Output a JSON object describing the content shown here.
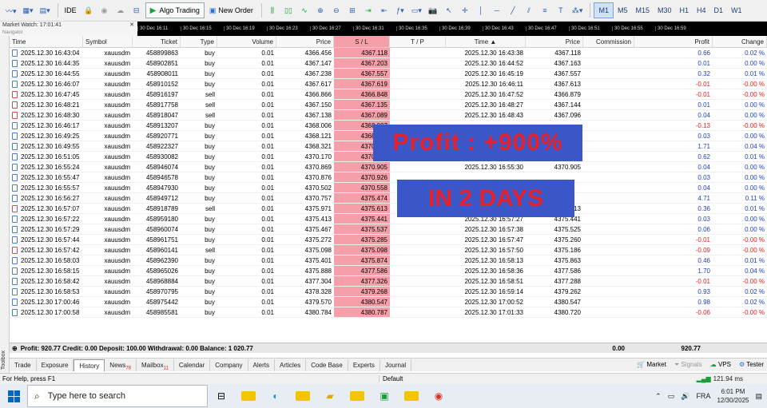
{
  "toolbar": {
    "ide_label": "IDE",
    "algo_label": "Algo Trading",
    "new_order_label": "New Order",
    "timeframes": [
      "M1",
      "M5",
      "M15",
      "M30",
      "H1",
      "H4",
      "D1",
      "W1"
    ],
    "active_timeframe": "M1"
  },
  "market_watch": {
    "title": "Market Watch: 17:01:41",
    "sub": "Navigator"
  },
  "timescale": [
    "30 Dec 16:11",
    "30 Dec 16:15",
    "30 Dec 16:19",
    "30 Dec 16:23",
    "30 Dec 16:27",
    "30 Dec 16:31",
    "30 Dec 16:35",
    "30 Dec 16:39",
    "30 Dec 16:43",
    "30 Dec 16:47",
    "30 Dec 16:51",
    "30 Dec 16:55",
    "30 Dec 16:59"
  ],
  "columns": {
    "time": "Time",
    "symbol": "Symbol",
    "ticket": "Ticket",
    "type": "Type",
    "volume": "Volume",
    "price": "Price",
    "sl": "S / L",
    "tp": "T / P",
    "close_time": "Time ▲",
    "close_price": "Price",
    "commission": "Commission",
    "profit": "Profit",
    "change": "Change"
  },
  "rows": [
    {
      "time": "2025.12.30 16:43:04",
      "symbol": "xauusdm",
      "ticket": "458899863",
      "type": "buy",
      "volume": "0.01",
      "price": "4366.456",
      "sl": "4367.118",
      "tp": "",
      "ctime": "2025.12.30 16:43:38",
      "cprice": "4367.118",
      "comm": "",
      "profit": "0.66",
      "change": "0.02 %",
      "neg": false
    },
    {
      "time": "2025.12.30 16:44:35",
      "symbol": "xauusdm",
      "ticket": "458902851",
      "type": "buy",
      "volume": "0.01",
      "price": "4367.147",
      "sl": "4367.203",
      "tp": "",
      "ctime": "2025.12.30 16:44:52",
      "cprice": "4367.163",
      "comm": "",
      "profit": "0.01",
      "change": "0.00 %",
      "neg": false
    },
    {
      "time": "2025.12.30 16:44:55",
      "symbol": "xauusdm",
      "ticket": "458908011",
      "type": "buy",
      "volume": "0.01",
      "price": "4367.238",
      "sl": "4367.557",
      "tp": "",
      "ctime": "2025.12.30 16:45:19",
      "cprice": "4367.557",
      "comm": "",
      "profit": "0.32",
      "change": "0.01 %",
      "neg": false
    },
    {
      "time": "2025.12.30 16:46:07",
      "symbol": "xauusdm",
      "ticket": "458910152",
      "type": "buy",
      "volume": "0.01",
      "price": "4367.617",
      "sl": "4367.619",
      "tp": "",
      "ctime": "2025.12.30 16:46:11",
      "cprice": "4367.613",
      "comm": "",
      "profit": "-0.01",
      "change": "-0.00 %",
      "neg": true
    },
    {
      "time": "2025.12.30 16:47:45",
      "symbol": "xauusdm",
      "ticket": "458916197",
      "type": "sell",
      "volume": "0.01",
      "price": "4366.866",
      "sl": "4366.848",
      "tp": "",
      "ctime": "2025.12.30 16:47:52",
      "cprice": "4366.879",
      "comm": "",
      "profit": "-0.01",
      "change": "-0.00 %",
      "neg": true
    },
    {
      "time": "2025.12.30 16:48:21",
      "symbol": "xauusdm",
      "ticket": "458917758",
      "type": "sell",
      "volume": "0.01",
      "price": "4367.150",
      "sl": "4367.135",
      "tp": "",
      "ctime": "2025.12.30 16:48:27",
      "cprice": "4367.144",
      "comm": "",
      "profit": "0.01",
      "change": "0.00 %",
      "neg": false
    },
    {
      "time": "2025.12.30 16:48:30",
      "symbol": "xauusdm",
      "ticket": "458918047",
      "type": "sell",
      "volume": "0.01",
      "price": "4367.138",
      "sl": "4367.089",
      "tp": "",
      "ctime": "2025.12.30 16:48:43",
      "cprice": "4367.096",
      "comm": "",
      "profit": "0.04",
      "change": "0.00 %",
      "neg": false
    },
    {
      "time": "2025.12.30 16:46:17",
      "symbol": "xauusdm",
      "ticket": "458913207",
      "type": "buy",
      "volume": "0.01",
      "price": "4368.006",
      "sl": "4368.007",
      "tp": "",
      "ctime": "",
      "cprice": "",
      "comm": "",
      "profit": "-0.13",
      "change": "-0.00 %",
      "neg": true
    },
    {
      "time": "2025.12.30 16:49:25",
      "symbol": "xauusdm",
      "ticket": "458920771",
      "type": "buy",
      "volume": "0.01",
      "price": "4368.121",
      "sl": "4368.155",
      "tp": "",
      "ctime": "",
      "cprice": "",
      "comm": "",
      "profit": "0.03",
      "change": "0.00 %",
      "neg": false
    },
    {
      "time": "2025.12.30 16:49:55",
      "symbol": "xauusdm",
      "ticket": "458922327",
      "type": "buy",
      "volume": "0.01",
      "price": "4368.321",
      "sl": "4370.051",
      "tp": "",
      "ctime": "",
      "cprice": "",
      "comm": "",
      "profit": "1.71",
      "change": "0.04 %",
      "neg": false
    },
    {
      "time": "2025.12.30 16:51:05",
      "symbol": "xauusdm",
      "ticket": "458930082",
      "type": "buy",
      "volume": "0.01",
      "price": "4370.170",
      "sl": "4370.786",
      "tp": "",
      "ctime": "2025.12.30 16:55:20",
      "cprice": "4370.786",
      "comm": "",
      "profit": "0.62",
      "change": "0.01 %",
      "neg": false
    },
    {
      "time": "2025.12.30 16:55:24",
      "symbol": "xauusdm",
      "ticket": "458946074",
      "type": "buy",
      "volume": "0.01",
      "price": "4370.869",
      "sl": "4370.905",
      "tp": "",
      "ctime": "2025.12.30 16:55:30",
      "cprice": "4370.905",
      "comm": "",
      "profit": "0.04",
      "change": "0.00 %",
      "neg": false
    },
    {
      "time": "2025.12.30 16:55:47",
      "symbol": "xauusdm",
      "ticket": "458946578",
      "type": "buy",
      "volume": "0.01",
      "price": "4370.876",
      "sl": "4370.926",
      "tp": "",
      "ctime": "",
      "cprice": "",
      "comm": "",
      "profit": "0.03",
      "change": "0.00 %",
      "neg": false
    },
    {
      "time": "2025.12.30 16:55:57",
      "symbol": "xauusdm",
      "ticket": "458947930",
      "type": "buy",
      "volume": "0.01",
      "price": "4370.502",
      "sl": "4370.558",
      "tp": "",
      "ctime": "",
      "cprice": "",
      "comm": "",
      "profit": "0.04",
      "change": "0.00 %",
      "neg": false
    },
    {
      "time": "2025.12.30 16:56:27",
      "symbol": "xauusdm",
      "ticket": "458949712",
      "type": "buy",
      "volume": "0.01",
      "price": "4370.757",
      "sl": "4375.474",
      "tp": "",
      "ctime": "",
      "cprice": "",
      "comm": "",
      "profit": "4.71",
      "change": "0.11 %",
      "neg": false
    },
    {
      "time": "2025.12.30 16:57:07",
      "symbol": "xauusdm",
      "ticket": "458918789",
      "type": "sell",
      "volume": "0.01",
      "price": "4375.971",
      "sl": "4375.613",
      "tp": "",
      "ctime": "2025.12.30 16:57:25",
      "cprice": "4375.613",
      "comm": "",
      "profit": "0.36",
      "change": "0.01 %",
      "neg": false
    },
    {
      "time": "2025.12.30 16:57:22",
      "symbol": "xauusdm",
      "ticket": "458959180",
      "type": "buy",
      "volume": "0.01",
      "price": "4375.413",
      "sl": "4375.441",
      "tp": "",
      "ctime": "2025.12.30 16:57:27",
      "cprice": "4375.441",
      "comm": "",
      "profit": "0.03",
      "change": "0.00 %",
      "neg": false
    },
    {
      "time": "2025.12.30 16:57:29",
      "symbol": "xauusdm",
      "ticket": "458960074",
      "type": "buy",
      "volume": "0.01",
      "price": "4375.467",
      "sl": "4375.537",
      "tp": "",
      "ctime": "2025.12.30 16:57:38",
      "cprice": "4375.525",
      "comm": "",
      "profit": "0.06",
      "change": "0.00 %",
      "neg": false
    },
    {
      "time": "2025.12.30 16:57:44",
      "symbol": "xauusdm",
      "ticket": "458961751",
      "type": "buy",
      "volume": "0.01",
      "price": "4375.272",
      "sl": "4375.285",
      "tp": "",
      "ctime": "2025.12.30 16:57:47",
      "cprice": "4375.260",
      "comm": "",
      "profit": "-0.01",
      "change": "-0.00 %",
      "neg": true
    },
    {
      "time": "2025.12.30 16:57:42",
      "symbol": "xauusdm",
      "ticket": "458960141",
      "type": "sell",
      "volume": "0.01",
      "price": "4375.098",
      "sl": "4375.098",
      "tp": "",
      "ctime": "2025.12.30 16:57:50",
      "cprice": "4375.186",
      "comm": "",
      "profit": "-0.09",
      "change": "-0.00 %",
      "neg": true
    },
    {
      "time": "2025.12.30 16:58:03",
      "symbol": "xauusdm",
      "ticket": "458962390",
      "type": "buy",
      "volume": "0.01",
      "price": "4375.401",
      "sl": "4375.874",
      "tp": "",
      "ctime": "2025.12.30 16:58:13",
      "cprice": "4375.863",
      "comm": "",
      "profit": "0.46",
      "change": "0.01 %",
      "neg": false
    },
    {
      "time": "2025.12.30 16:58:15",
      "symbol": "xauusdm",
      "ticket": "458965026",
      "type": "buy",
      "volume": "0.01",
      "price": "4375.888",
      "sl": "4377.586",
      "tp": "",
      "ctime": "2025.12.30 16:58:36",
      "cprice": "4377.586",
      "comm": "",
      "profit": "1.70",
      "change": "0.04 %",
      "neg": false
    },
    {
      "time": "2025.12.30 16:58:42",
      "symbol": "xauusdm",
      "ticket": "458968884",
      "type": "buy",
      "volume": "0.01",
      "price": "4377.304",
      "sl": "4377.326",
      "tp": "",
      "ctime": "2025.12.30 16:58:51",
      "cprice": "4377.288",
      "comm": "",
      "profit": "-0.01",
      "change": "-0.00 %",
      "neg": true
    },
    {
      "time": "2025.12.30 16:58:53",
      "symbol": "xauusdm",
      "ticket": "458970795",
      "type": "buy",
      "volume": "0.01",
      "price": "4378.328",
      "sl": "4379.268",
      "tp": "",
      "ctime": "2025.12.30 16:59:14",
      "cprice": "4379.262",
      "comm": "",
      "profit": "0.93",
      "change": "0.02 %",
      "neg": false
    },
    {
      "time": "2025.12.30 17:00:46",
      "symbol": "xauusdm",
      "ticket": "458975442",
      "type": "buy",
      "volume": "0.01",
      "price": "4379.570",
      "sl": "4380.547",
      "tp": "",
      "ctime": "2025.12.30 17:00:52",
      "cprice": "4380.547",
      "comm": "",
      "profit": "0.98",
      "change": "0.02 %",
      "neg": false
    },
    {
      "time": "2025.12.30 17:00:58",
      "symbol": "xauusdm",
      "ticket": "458985581",
      "type": "buy",
      "volume": "0.01",
      "price": "4380.784",
      "sl": "4380.787",
      "tp": "",
      "ctime": "2025.12.30 17:01:33",
      "cprice": "4380.720",
      "comm": "",
      "profit": "-0.06",
      "change": "-0.00 %",
      "neg": true
    }
  ],
  "summary": {
    "text": "Profit: 920.77  Credit: 0.00  Deposit: 100.00  Withdrawal: 0.00  Balance: 1 020.77",
    "commission": "0.00",
    "profit": "920.77"
  },
  "tabs": [
    {
      "label": "Trade",
      "badge": ""
    },
    {
      "label": "Exposure",
      "badge": ""
    },
    {
      "label": "History",
      "badge": ""
    },
    {
      "label": "News",
      "badge": "78"
    },
    {
      "label": "Mailbox",
      "badge": "11"
    },
    {
      "label": "Calendar",
      "badge": ""
    },
    {
      "label": "Company",
      "badge": ""
    },
    {
      "label": "Alerts",
      "badge": ""
    },
    {
      "label": "Articles",
      "badge": ""
    },
    {
      "label": "Code Base",
      "badge": ""
    },
    {
      "label": "Experts",
      "badge": ""
    },
    {
      "label": "Journal",
      "badge": ""
    }
  ],
  "active_tab": "History",
  "tabs_right": {
    "market": "Market",
    "signals": "Signals",
    "vps": "VPS",
    "tester": "Tester"
  },
  "toolbox_label": "Toolbox",
  "status": {
    "help": "For Help, press F1",
    "default": "Default",
    "ping": "121.94 ms"
  },
  "taskbar": {
    "search_placeholder": "Type here to search",
    "time": "6:01 PM",
    "date": "12/30/2025",
    "lang": "FRA"
  },
  "overlay": {
    "profit": "Profit : +900%",
    "days": "IN 2 DAYS"
  },
  "colors": {
    "sl_bg": "#f5a0a8",
    "positive": "#1f3fbf",
    "negative": "#e02020",
    "overlay_bg": "#3b56c7",
    "overlay_text": "#e8202a"
  }
}
